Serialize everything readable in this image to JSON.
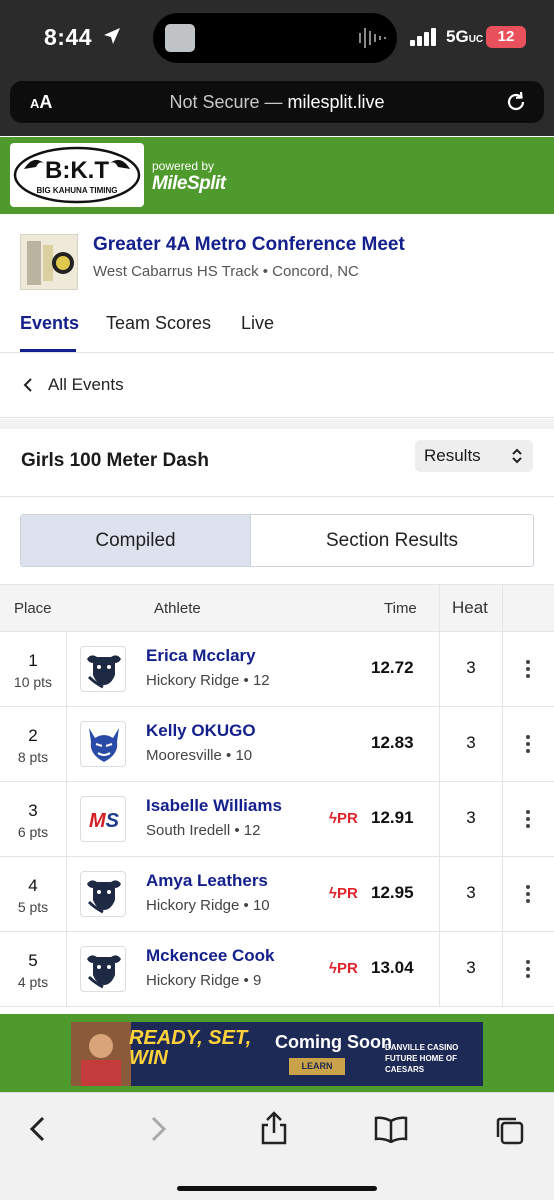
{
  "status_bar": {
    "time": "8:44",
    "network": "5G",
    "network_suffix": "UC",
    "battery": "12"
  },
  "browser": {
    "text_size_label": "AA",
    "security": "Not Secure",
    "separator": " — ",
    "domain": "milesplit.live"
  },
  "brand": {
    "logo_text": "B:K.T",
    "logo_sub": "BIG KAHUNA TIMING",
    "powered_by": "powered by",
    "partner": "MileSplit"
  },
  "meet": {
    "title": "Greater 4A Metro Conference Meet",
    "location": "West Cabarrus HS Track • Concord, NC"
  },
  "tabs": [
    {
      "label": "Events",
      "active": true
    },
    {
      "label": "Team Scores",
      "active": false
    },
    {
      "label": "Live",
      "active": false
    }
  ],
  "nav": {
    "back_label": "All Events"
  },
  "event": {
    "name": "Girls 100 Meter Dash",
    "view_select": "Results"
  },
  "toggle": {
    "left": "Compiled",
    "right": "Section Results",
    "active": "Compiled"
  },
  "table": {
    "headers": {
      "place": "Place",
      "athlete": "Athlete",
      "time": "Time",
      "heat": "Heat"
    },
    "rows": [
      {
        "place": "1",
        "pts": "10 pts",
        "name": "Erica Mcclary",
        "team": "Hickory Ridge • 12",
        "pr": "",
        "time": "12.72",
        "heat": "3",
        "logo": "bull"
      },
      {
        "place": "2",
        "pts": "8 pts",
        "name": "Kelly OKUGO",
        "team": "Mooresville • 10",
        "pr": "",
        "time": "12.83",
        "heat": "3",
        "logo": "devil"
      },
      {
        "place": "3",
        "pts": "6 pts",
        "name": "Isabelle Williams",
        "team": "South Iredell • 12",
        "pr": "PR",
        "time": "12.91",
        "heat": "3",
        "logo": "ms"
      },
      {
        "place": "4",
        "pts": "5 pts",
        "name": "Amya Leathers",
        "team": "Hickory Ridge • 10",
        "pr": "PR",
        "time": "12.95",
        "heat": "3",
        "logo": "bull"
      },
      {
        "place": "5",
        "pts": "4 pts",
        "name": "Mckencee Cook",
        "team": "Hickory Ridge • 9",
        "pr": "PR",
        "time": "13.04",
        "heat": "3",
        "logo": "bull"
      }
    ]
  },
  "ad": {
    "headline": "READY, SET, WIN",
    "cta_title": "Coming Soon",
    "cta_button": "LEARN MORE",
    "sponsor": "DANVILLE CASINO",
    "sponsor_tag": "FUTURE HOME OF CAESARS"
  },
  "colors": {
    "accent_navy": "#14208c",
    "brand_green": "#4e9a2c",
    "pr_red": "#e0222a"
  }
}
